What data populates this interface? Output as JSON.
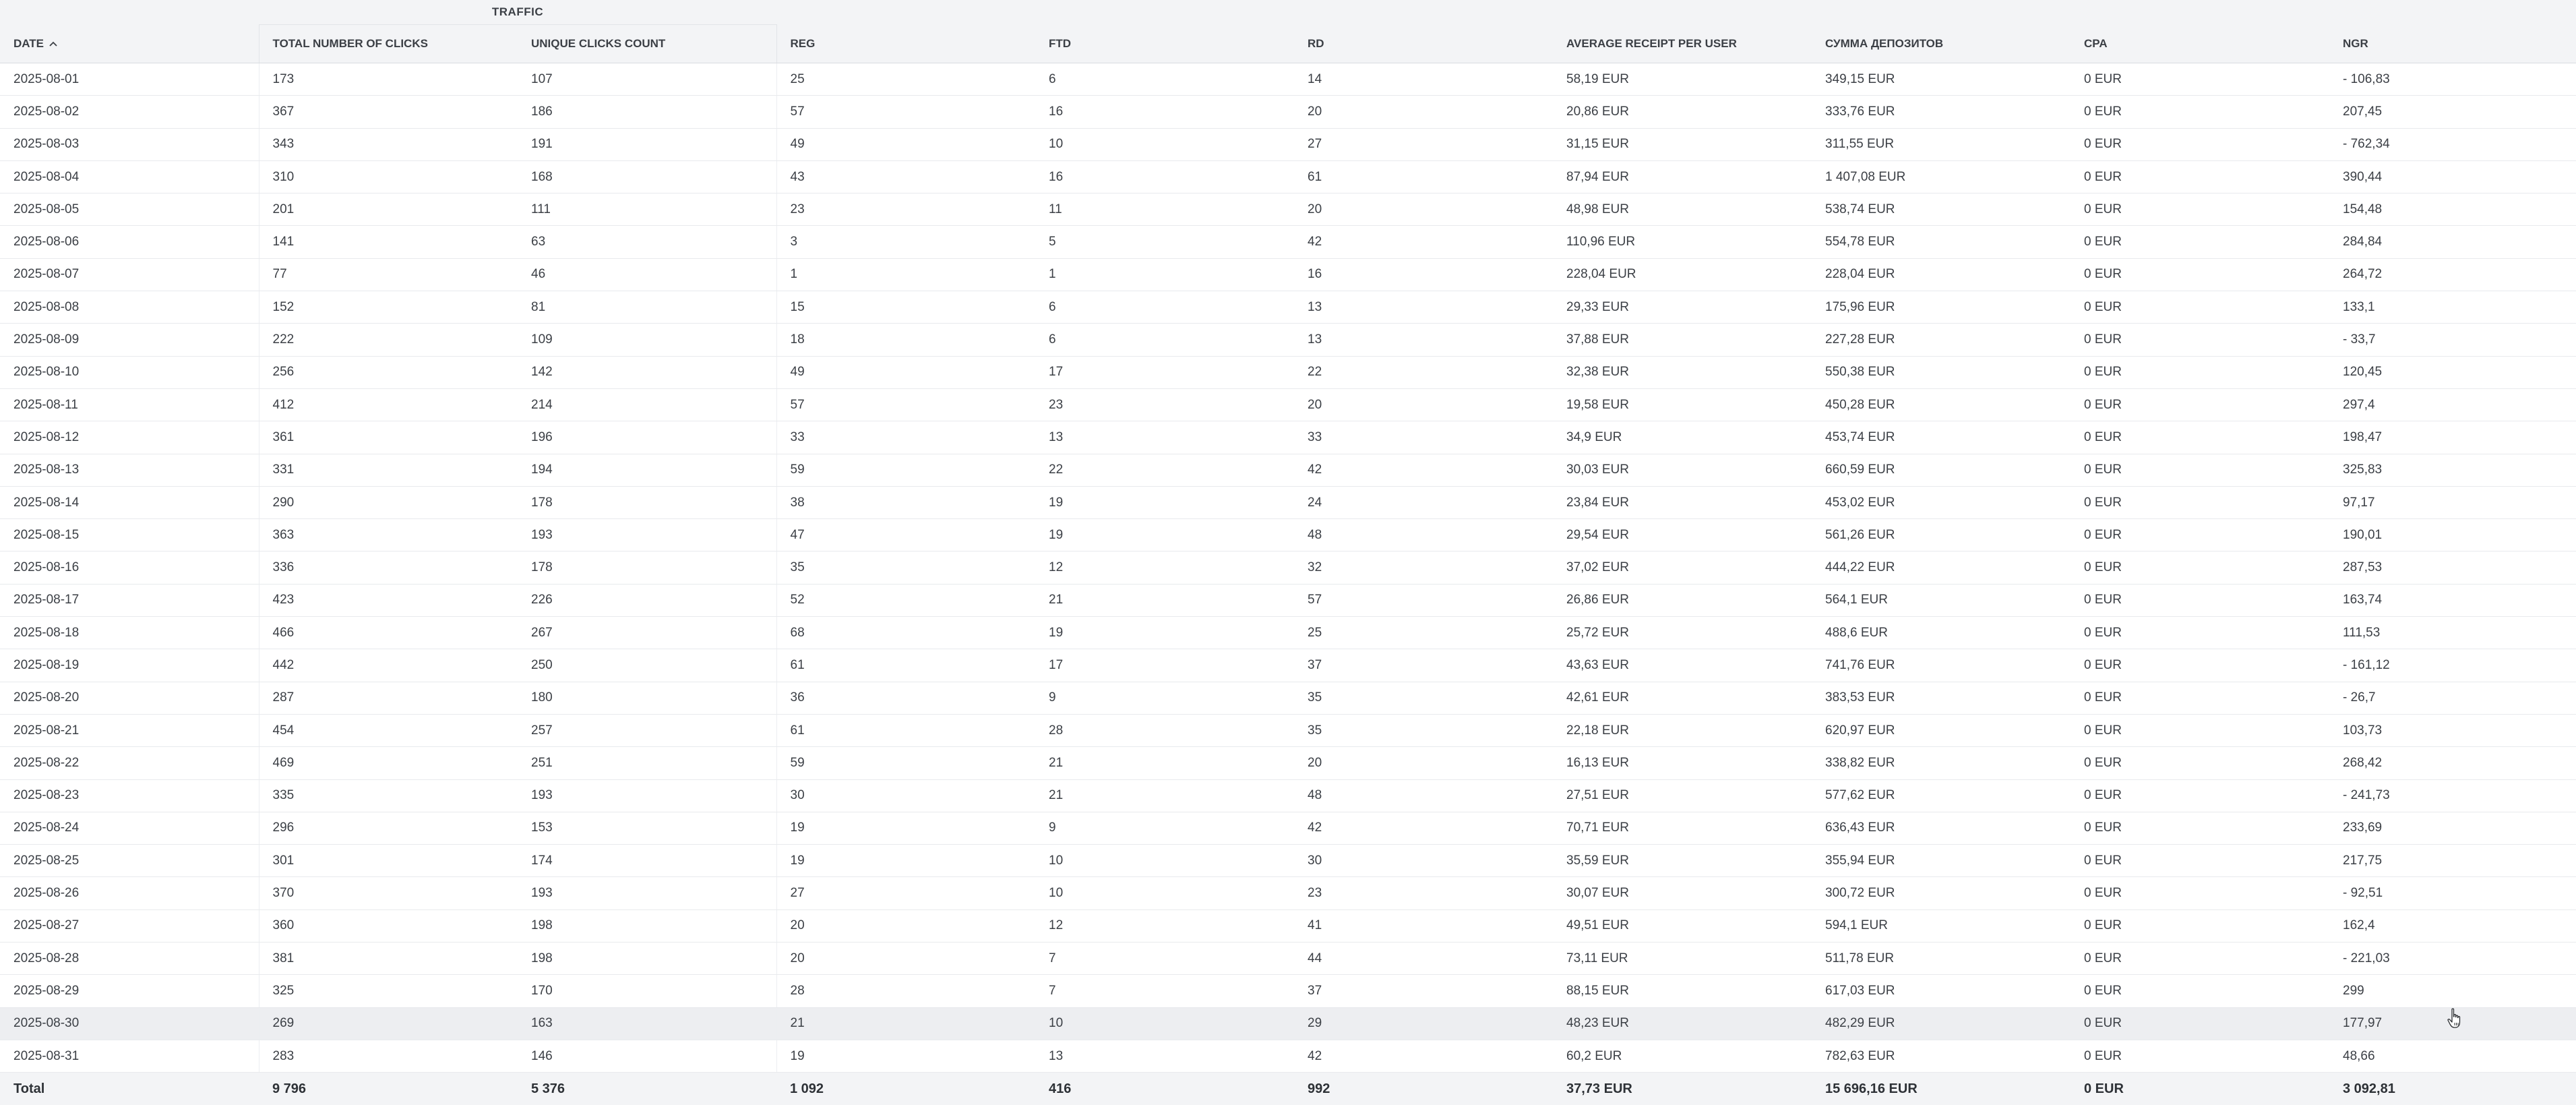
{
  "table": {
    "group_header": "TRAFFIC",
    "columns": [
      "DATE",
      "TOTAL NUMBER OF CLICKS",
      "UNIQUE CLICKS COUNT",
      "REG",
      "FTD",
      "RD",
      "AVERAGE RECEIPT PER USER",
      "СУММА ДЕПОЗИТОВ",
      "CPA",
      "NGR"
    ],
    "sort": {
      "column": "DATE",
      "direction": "ascending",
      "icon": "chevron-up-icon"
    },
    "rows": [
      [
        "2025-08-01",
        "173",
        "107",
        "25",
        "6",
        "14",
        "58,19 EUR",
        "349,15 EUR",
        "0 EUR",
        "- 106,83"
      ],
      [
        "2025-08-02",
        "367",
        "186",
        "57",
        "16",
        "20",
        "20,86 EUR",
        "333,76 EUR",
        "0 EUR",
        "207,45"
      ],
      [
        "2025-08-03",
        "343",
        "191",
        "49",
        "10",
        "27",
        "31,15 EUR",
        "311,55 EUR",
        "0 EUR",
        "- 762,34"
      ],
      [
        "2025-08-04",
        "310",
        "168",
        "43",
        "16",
        "61",
        "87,94 EUR",
        "1 407,08 EUR",
        "0 EUR",
        "390,44"
      ],
      [
        "2025-08-05",
        "201",
        "111",
        "23",
        "11",
        "20",
        "48,98 EUR",
        "538,74 EUR",
        "0 EUR",
        "154,48"
      ],
      [
        "2025-08-06",
        "141",
        "63",
        "3",
        "5",
        "42",
        "110,96 EUR",
        "554,78 EUR",
        "0 EUR",
        "284,84"
      ],
      [
        "2025-08-07",
        "77",
        "46",
        "1",
        "1",
        "16",
        "228,04 EUR",
        "228,04 EUR",
        "0 EUR",
        "264,72"
      ],
      [
        "2025-08-08",
        "152",
        "81",
        "15",
        "6",
        "13",
        "29,33 EUR",
        "175,96 EUR",
        "0 EUR",
        "133,1"
      ],
      [
        "2025-08-09",
        "222",
        "109",
        "18",
        "6",
        "13",
        "37,88 EUR",
        "227,28 EUR",
        "0 EUR",
        "- 33,7"
      ],
      [
        "2025-08-10",
        "256",
        "142",
        "49",
        "17",
        "22",
        "32,38 EUR",
        "550,38 EUR",
        "0 EUR",
        "120,45"
      ],
      [
        "2025-08-11",
        "412",
        "214",
        "57",
        "23",
        "20",
        "19,58 EUR",
        "450,28 EUR",
        "0 EUR",
        "297,4"
      ],
      [
        "2025-08-12",
        "361",
        "196",
        "33",
        "13",
        "33",
        "34,9 EUR",
        "453,74 EUR",
        "0 EUR",
        "198,47"
      ],
      [
        "2025-08-13",
        "331",
        "194",
        "59",
        "22",
        "42",
        "30,03 EUR",
        "660,59 EUR",
        "0 EUR",
        "325,83"
      ],
      [
        "2025-08-14",
        "290",
        "178",
        "38",
        "19",
        "24",
        "23,84 EUR",
        "453,02 EUR",
        "0 EUR",
        "97,17"
      ],
      [
        "2025-08-15",
        "363",
        "193",
        "47",
        "19",
        "48",
        "29,54 EUR",
        "561,26 EUR",
        "0 EUR",
        "190,01"
      ],
      [
        "2025-08-16",
        "336",
        "178",
        "35",
        "12",
        "32",
        "37,02 EUR",
        "444,22 EUR",
        "0 EUR",
        "287,53"
      ],
      [
        "2025-08-17",
        "423",
        "226",
        "52",
        "21",
        "57",
        "26,86 EUR",
        "564,1 EUR",
        "0 EUR",
        "163,74"
      ],
      [
        "2025-08-18",
        "466",
        "267",
        "68",
        "19",
        "25",
        "25,72 EUR",
        "488,6 EUR",
        "0 EUR",
        "111,53"
      ],
      [
        "2025-08-19",
        "442",
        "250",
        "61",
        "17",
        "37",
        "43,63 EUR",
        "741,76 EUR",
        "0 EUR",
        "- 161,12"
      ],
      [
        "2025-08-20",
        "287",
        "180",
        "36",
        "9",
        "35",
        "42,61 EUR",
        "383,53 EUR",
        "0 EUR",
        "- 26,7"
      ],
      [
        "2025-08-21",
        "454",
        "257",
        "61",
        "28",
        "35",
        "22,18 EUR",
        "620,97 EUR",
        "0 EUR",
        "103,73"
      ],
      [
        "2025-08-22",
        "469",
        "251",
        "59",
        "21",
        "20",
        "16,13 EUR",
        "338,82 EUR",
        "0 EUR",
        "268,42"
      ],
      [
        "2025-08-23",
        "335",
        "193",
        "30",
        "21",
        "48",
        "27,51 EUR",
        "577,62 EUR",
        "0 EUR",
        "- 241,73"
      ],
      [
        "2025-08-24",
        "296",
        "153",
        "19",
        "9",
        "42",
        "70,71 EUR",
        "636,43 EUR",
        "0 EUR",
        "233,69"
      ],
      [
        "2025-08-25",
        "301",
        "174",
        "19",
        "10",
        "30",
        "35,59 EUR",
        "355,94 EUR",
        "0 EUR",
        "217,75"
      ],
      [
        "2025-08-26",
        "370",
        "193",
        "27",
        "10",
        "23",
        "30,07 EUR",
        "300,72 EUR",
        "0 EUR",
        "- 92,51"
      ],
      [
        "2025-08-27",
        "360",
        "198",
        "20",
        "12",
        "41",
        "49,51 EUR",
        "594,1 EUR",
        "0 EUR",
        "162,4"
      ],
      [
        "2025-08-28",
        "381",
        "198",
        "20",
        "7",
        "44",
        "73,11 EUR",
        "511,78 EUR",
        "0 EUR",
        "- 221,03"
      ],
      [
        "2025-08-29",
        "325",
        "170",
        "28",
        "7",
        "37",
        "88,15 EUR",
        "617,03 EUR",
        "0 EUR",
        "299"
      ],
      [
        "2025-08-30",
        "269",
        "163",
        "21",
        "10",
        "29",
        "48,23 EUR",
        "482,29 EUR",
        "0 EUR",
        "177,97"
      ],
      [
        "2025-08-31",
        "283",
        "146",
        "19",
        "13",
        "42",
        "60,2 EUR",
        "782,63 EUR",
        "0 EUR",
        "48,66"
      ]
    ],
    "hovered_row": "2025-08-30",
    "total": [
      "Total",
      "9 796",
      "5 376",
      "1 092",
      "416",
      "992",
      "37,73 EUR",
      "15 696,16 EUR",
      "0 EUR",
      "3 092,81"
    ]
  },
  "colors": {
    "header_bg": "#f3f4f6",
    "hover_row_bg": "#edeef1",
    "text": "#3b3f45"
  },
  "cursor": {
    "icon": "hand-pointer-icon"
  }
}
